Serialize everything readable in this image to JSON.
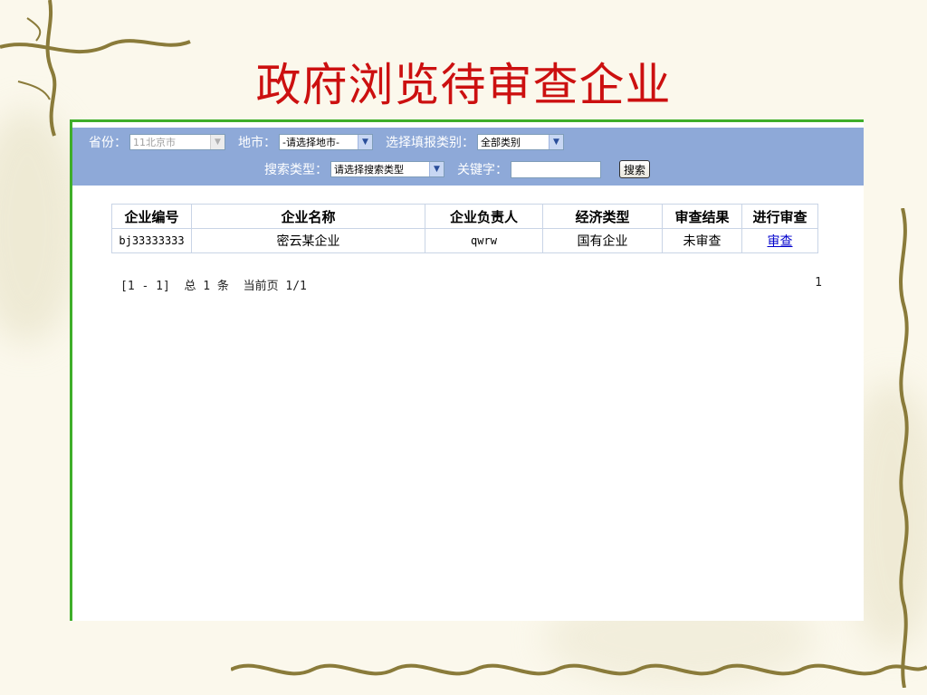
{
  "slide": {
    "title": "政府浏览待审查企业"
  },
  "filters": {
    "province_label": "省份：",
    "province_value": "11北京市",
    "city_label": "地市：",
    "city_value": "-请选择地市-",
    "report_type_label": "选择填报类别：",
    "report_type_value": "全部类别",
    "search_type_label": "搜索类型：",
    "search_type_value": "请选择搜索类型",
    "keyword_label": "关键字：",
    "keyword_value": "",
    "search_button": "搜索"
  },
  "table": {
    "headers": [
      "企业编号",
      "企业名称",
      "企业负责人",
      "经济类型",
      "审查结果",
      "进行审查"
    ],
    "rows": [
      {
        "id": "bj33333333",
        "name": "密云某企业",
        "manager": "qwrw",
        "econ_type": "国有企业",
        "result": "未审查",
        "action": "审查"
      }
    ]
  },
  "pager": {
    "summary": "[1 - 1]  总 1 条  当前页 1/1",
    "page_link": "1"
  },
  "colors": {
    "title": "#cc1010",
    "panel": "#8ea9d8",
    "frame_border": "#3fae2a",
    "link": "#0000cc"
  }
}
